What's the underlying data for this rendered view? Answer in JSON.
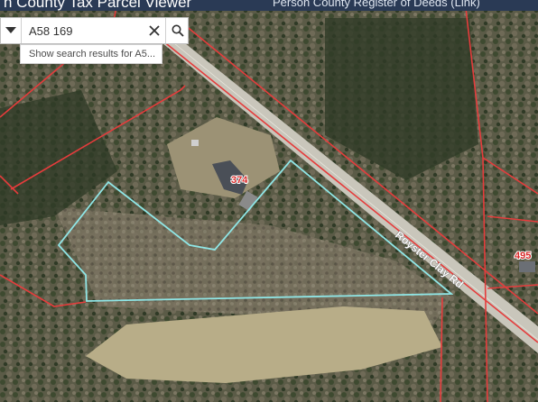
{
  "header": {
    "title": "n County Tax Parcel Viewer",
    "link": "Person County Register of Deeds (Link)"
  },
  "search": {
    "value": "A58 169",
    "suggestion": "Show search results for A5..."
  },
  "map": {
    "road_label": "Royster Clay Rd",
    "parcel_labels": [
      "374",
      "495"
    ],
    "colors": {
      "parcel_boundary": "#e53c3c",
      "selected_parcel": "#8fe6e6",
      "parcel_label": "#d92b2b"
    }
  }
}
